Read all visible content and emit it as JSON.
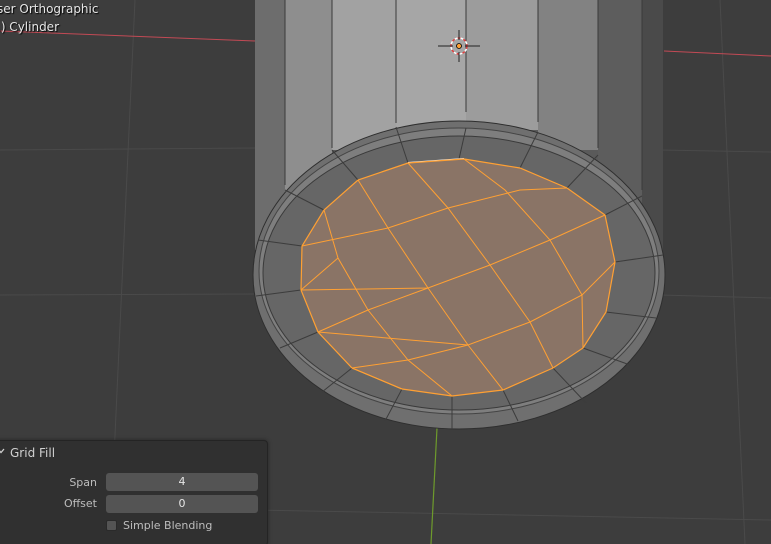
{
  "viewport": {
    "view_name": "ser Orthographic",
    "object_name": ".) Cylinder"
  },
  "icons": {
    "cursor": "3d-cursor-icon",
    "origin": "object-origin-icon",
    "collapse": "chevron-down-icon",
    "checkbox": "checkbox-icon"
  },
  "colors": {
    "background": "#3d3d3d",
    "x_axis": "#c24a55",
    "y_axis": "#6e9b2c",
    "selection": "#ffa033",
    "selected_face_fill": "#8a7466",
    "panel_bg": "#303030",
    "field_bg": "#545454"
  },
  "redo_panel": {
    "title": "Grid Fill",
    "span": {
      "label": "Span",
      "value": "4"
    },
    "offset": {
      "label": "Offset",
      "value": "0"
    },
    "simple_blending": {
      "label": "Simple Blending",
      "checked": false
    }
  }
}
